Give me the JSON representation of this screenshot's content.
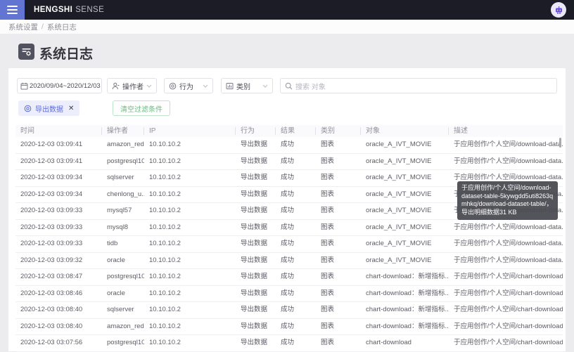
{
  "header": {
    "logo_bold": "HENGSHI",
    "logo_light": "SENSE"
  },
  "breadcrumb": {
    "items": [
      "系统设置",
      "系统日志"
    ],
    "separator": "/"
  },
  "page": {
    "title": "系统日志"
  },
  "filters": {
    "date_range": "2020/09/04~2020/12/03",
    "operator_label": "操作者",
    "action_label": "行为",
    "category_label": "类别",
    "search_placeholder": "搜索 对象"
  },
  "active_filters": {
    "tag_label": "导出数据",
    "tag_close": "✕",
    "clear_button": "清空过滤条件"
  },
  "table": {
    "columns": [
      "时间",
      "操作者",
      "IP",
      "行为",
      "结果",
      "类别",
      "对象",
      "描述"
    ],
    "column_keys": [
      "time",
      "operator",
      "ip",
      "action",
      "result",
      "category",
      "object",
      "description"
    ],
    "rows": [
      [
        "2020-12-03 03:09:41",
        "amazon_red...",
        "10.10.10.2",
        "导出数据",
        "成功",
        "图表",
        "oracle_A_IVT_MOVIE",
        "于应用创作/个人空间/download-data..."
      ],
      [
        "2020-12-03 03:09:41",
        "postgresql10",
        "10.10.10.2",
        "导出数据",
        "成功",
        "图表",
        "oracle_A_IVT_MOVIE",
        "于应用创作/个人空间/download-data..."
      ],
      [
        "2020-12-03 03:09:34",
        "sqlserver",
        "10.10.10.2",
        "导出数据",
        "成功",
        "图表",
        "oracle_A_IVT_MOVIE",
        "于应用创作/个人空间/download-data..."
      ],
      [
        "2020-12-03 03:09:34",
        "chenlong_u...",
        "10.10.10.2",
        "导出数据",
        "成功",
        "图表",
        "oracle_A_IVT_MOVIE",
        "于应用创作/个人空间/download-data..."
      ],
      [
        "2020-12-03 03:09:33",
        "mysql57",
        "10.10.10.2",
        "导出数据",
        "成功",
        "图表",
        "oracle_A_IVT_MOVIE",
        "于应用创作/个人空间/download-data..."
      ],
      [
        "2020-12-03 03:09:33",
        "mysql8",
        "10.10.10.2",
        "导出数据",
        "成功",
        "图表",
        "oracle_A_IVT_MOVIE",
        "于应用创作/个人空间/download-data..."
      ],
      [
        "2020-12-03 03:09:33",
        "tidb",
        "10.10.10.2",
        "导出数据",
        "成功",
        "图表",
        "oracle_A_IVT_MOVIE",
        "于应用创作/个人空间/download-data..."
      ],
      [
        "2020-12-03 03:09:32",
        "oracle",
        "10.10.10.2",
        "导出数据",
        "成功",
        "图表",
        "oracle_A_IVT_MOVIE",
        "于应用创作/个人空间/download-data..."
      ],
      [
        "2020-12-03 03:08:47",
        "postgresql10",
        "10.10.10.2",
        "导出数据",
        "成功",
        "图表",
        "chart-download：新增指标...",
        "于应用创作/个人空间/chart-download..."
      ],
      [
        "2020-12-03 03:08:46",
        "oracle",
        "10.10.10.2",
        "导出数据",
        "成功",
        "图表",
        "chart-download：新增指标...",
        "于应用创作/个人空间/chart-download..."
      ],
      [
        "2020-12-03 03:08:40",
        "sqlserver",
        "10.10.10.2",
        "导出数据",
        "成功",
        "图表",
        "chart-download：新增指标...",
        "于应用创作/个人空间/chart-download..."
      ],
      [
        "2020-12-03 03:08:40",
        "amazon_red...",
        "10.10.10.2",
        "导出数据",
        "成功",
        "图表",
        "chart-download：新增指标...",
        "于应用创作/个人空间/chart-download..."
      ],
      [
        "2020-12-03 03:07:56",
        "postgresql10",
        "10.10.10.2",
        "导出数据",
        "成功",
        "图表",
        "chart-download",
        "于应用创作/个人空间/chart-download..."
      ]
    ]
  },
  "tooltip": {
    "text": "于应用创作/个人空间/download-dataset-table-5kywgdd5uti8263qmhkq/download-dataset-table/，导出明细数据31 KB"
  },
  "colors": {
    "topbar_bg": "#1c1c26",
    "hamburger_bg": "#6375d3",
    "accent_purple": "#5d6bd6",
    "tag_bg": "#edeefb",
    "clear_green": "#6fbb84",
    "page_bg": "#ececef",
    "tooltip_bg": "#49494f"
  }
}
